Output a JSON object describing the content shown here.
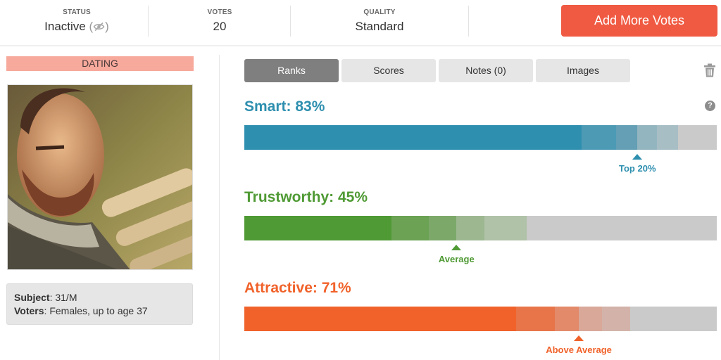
{
  "header": {
    "status": {
      "label": "STATUS",
      "value": "Inactive",
      "icon": "eye-slash-icon"
    },
    "votes": {
      "label": "VOTES",
      "value": "20"
    },
    "quality": {
      "label": "QUALITY",
      "value": "Standard"
    },
    "add_votes_label": "Add More Votes"
  },
  "sidebar": {
    "category": "DATING",
    "photo_alt": "Bearded man with scarf sitting on a park bench",
    "subject_label": "Subject",
    "subject_value": ": 31/M",
    "voters_label": "Voters",
    "voters_value": ": Females, up to age 37"
  },
  "tabs": [
    {
      "label": "Ranks",
      "active": true
    },
    {
      "label": "Scores",
      "active": false
    },
    {
      "label": "Notes (0)",
      "active": false
    },
    {
      "label": "Images",
      "active": false
    }
  ],
  "icons": {
    "delete": "trash-icon",
    "help": "question-icon"
  },
  "colors": {
    "accent": "#f05a42",
    "smart": "#2e8faf",
    "trustworthy": "#4f9a34",
    "attractive": "#f0622a",
    "track": "#cacaca"
  },
  "ranks": [
    {
      "name": "Smart",
      "title": "Smart: 83%",
      "percent": 83,
      "color": "#2e8faf",
      "band_colors": [
        "#2e8faf",
        "#4d9ab5",
        "#649fb5",
        "#93b5c0",
        "#a8bec5"
      ],
      "band_edges": [
        0,
        71.4,
        78.7,
        83.2,
        87.3,
        91.8
      ],
      "marker_label": "Top 20%",
      "marker_percent": 83.2
    },
    {
      "name": "Trustworthy",
      "title": "Trustworthy: 45%",
      "percent": 45,
      "color": "#4f9a34",
      "band_colors": [
        "#4f9a34",
        "#6ba254",
        "#7ca96a",
        "#9db891",
        "#b0c2a8"
      ],
      "band_edges": [
        0,
        31.1,
        39.0,
        44.9,
        50.8,
        59.8
      ],
      "marker_label": "Average",
      "marker_percent": 44.9
    },
    {
      "name": "Attractive",
      "title": "Attractive: 71%",
      "percent": 71,
      "color": "#f0622a",
      "band_colors": [
        "#f0622a",
        "#e77549",
        "#e38a6a",
        "#d9a898",
        "#d3b3a9"
      ],
      "band_edges": [
        0,
        57.5,
        65.7,
        70.8,
        75.7,
        81.7
      ],
      "marker_label": "Above Average",
      "marker_percent": 70.8
    }
  ]
}
